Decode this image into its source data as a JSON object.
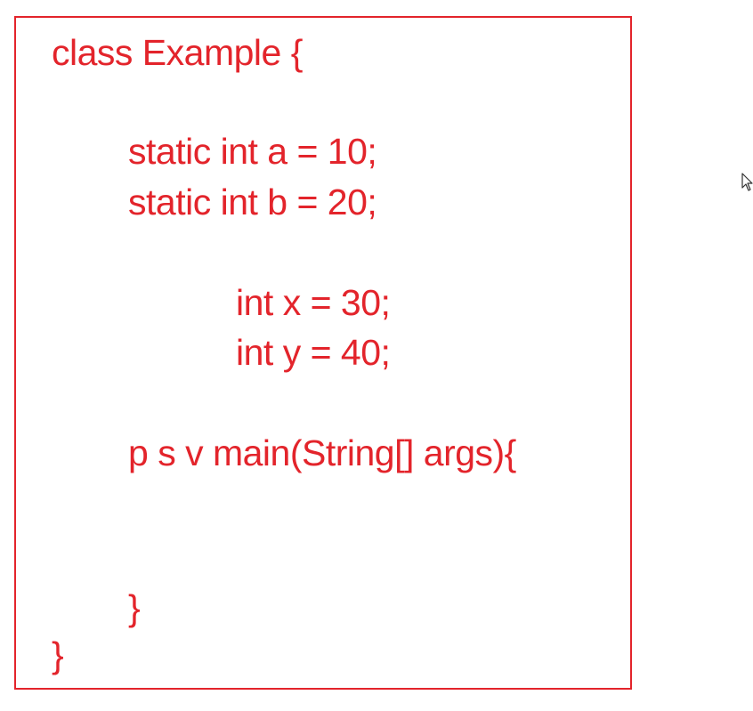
{
  "code": {
    "lines": [
      "class Example {",
      "static int a = 10;",
      "static int b = 20;",
      "int x = 30;",
      "int y = 40;",
      "p s v main(String[] args){",
      "}",
      "}"
    ]
  },
  "colors": {
    "text": "#e3242b",
    "border": "#e3242b",
    "background": "#ffffff"
  },
  "icons": {
    "pointer": "mouse-pointer-icon"
  }
}
